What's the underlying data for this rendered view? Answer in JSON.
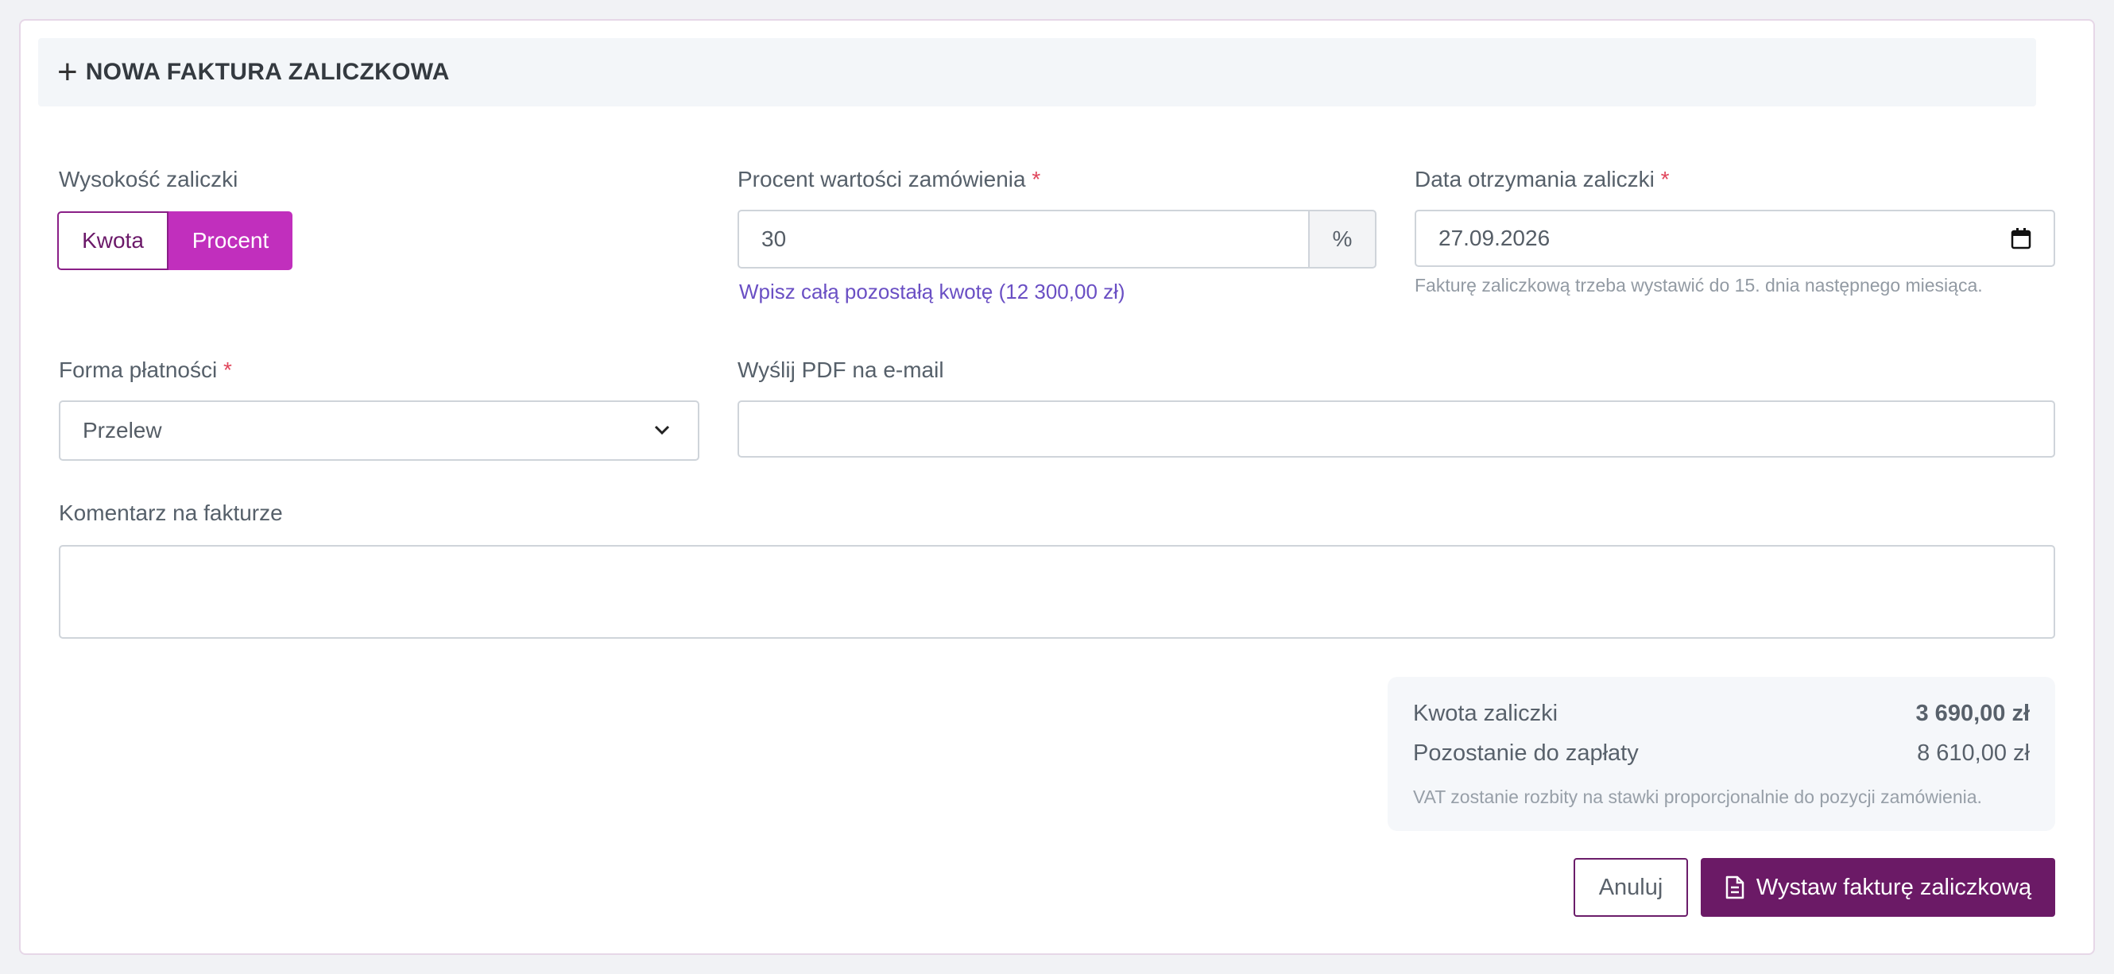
{
  "header": {
    "title": "NOWA FAKTURA ZALICZKOWA",
    "plus_icon": "plus-icon"
  },
  "amount_type": {
    "label": "Wysokość zaliczki",
    "options": [
      "Kwota",
      "Procent"
    ],
    "selected": "Procent"
  },
  "percent": {
    "label": "Procent wartości zamówienia",
    "required": "*",
    "value": "30",
    "addon": "%",
    "fill_link": "Wpisz całą pozostałą kwotę (12 300,00 zł)"
  },
  "date": {
    "label": "Data otrzymania zaliczki",
    "required": "*",
    "value": "27.09.2026",
    "help": "Fakturę zaliczkową trzeba wystawić do 15. dnia następnego miesiąca."
  },
  "payment": {
    "label": "Forma płatności",
    "required": "*",
    "value": "Przelew"
  },
  "email": {
    "label": "Wyślij PDF na e-mail",
    "value": ""
  },
  "comment": {
    "label": "Komentarz na fakturze",
    "value": ""
  },
  "summary": {
    "amount_label": "Kwota zaliczki",
    "amount_value": "3 690,00 zł",
    "remaining_label": "Pozostanie do zapłaty",
    "remaining_value": "8 610,00 zł",
    "note": "VAT zostanie rozbity na stawki proporcjonalnie do pozycji zamówienia."
  },
  "actions": {
    "cancel": "Anuluj",
    "submit": "Wystaw fakturę zaliczkową"
  },
  "colors": {
    "accent": "#c12fbd",
    "primary": "#6b1a66",
    "link": "#6a4fc4",
    "required": "#e0455b"
  }
}
